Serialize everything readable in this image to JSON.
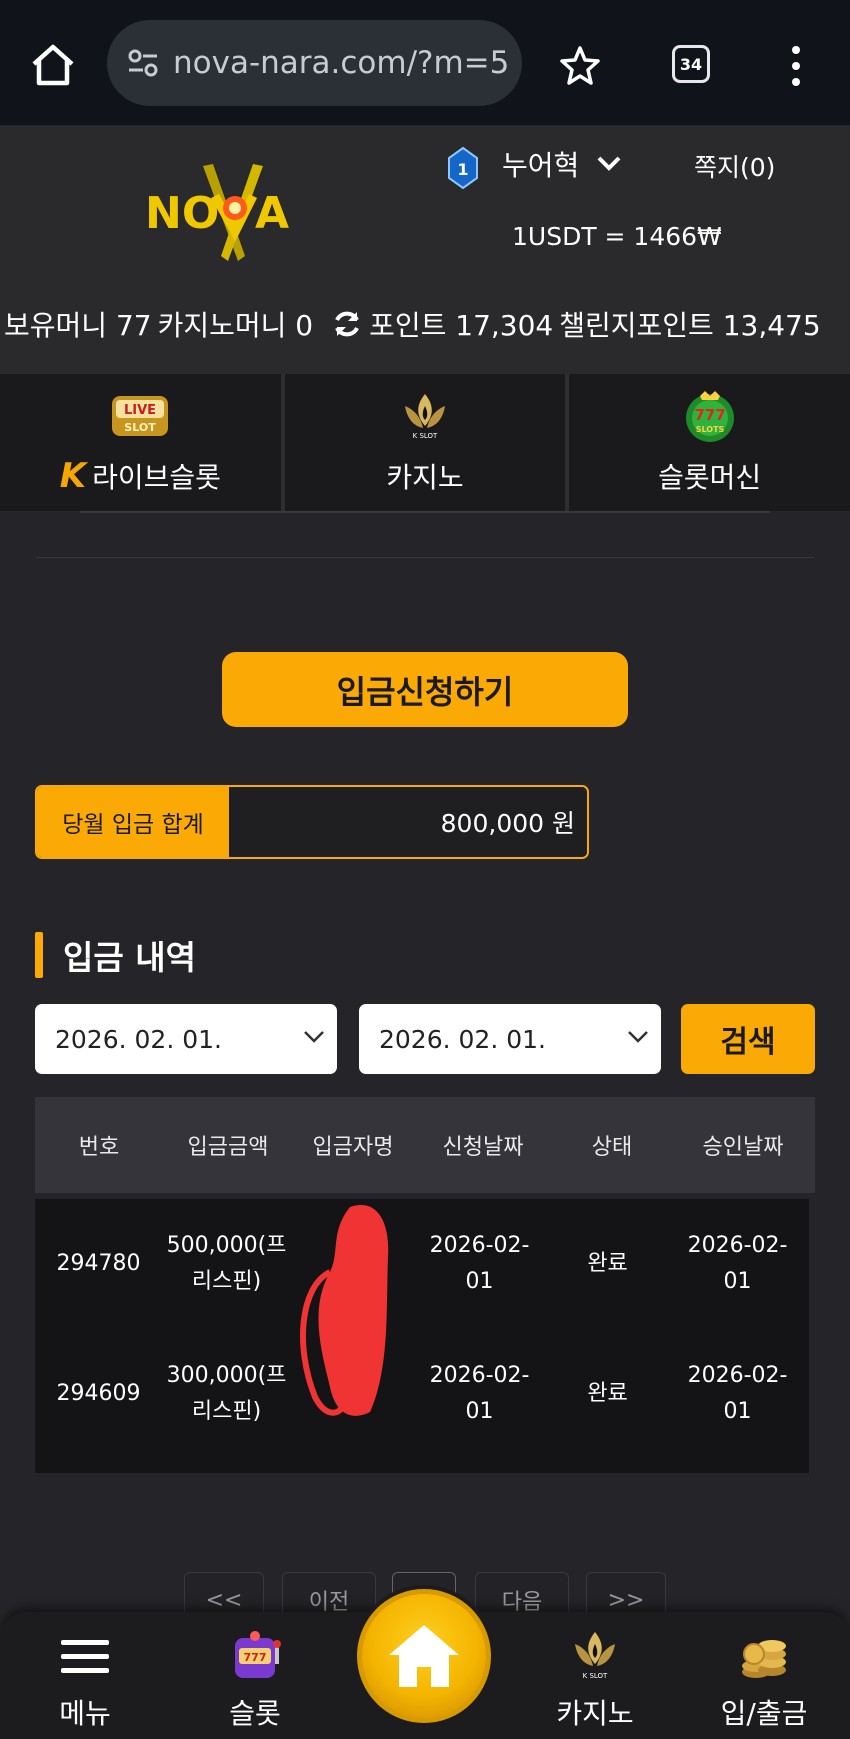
{
  "browser": {
    "url": "nova-nara.com/?m=5",
    "tab_count": "34"
  },
  "header": {
    "logo_text": "NOVA",
    "level": "1",
    "username": "누어혁",
    "messages": "쪽지(0)",
    "exchange_rate": "1USDT = 1466₩",
    "balances": {
      "holding": "보유머니 77",
      "casino": "카지노머니 0",
      "point": "포인트 17,304",
      "challenge": "챌린지포인트 13,475"
    }
  },
  "game_tabs": [
    {
      "label": "라이브슬롯",
      "icon": "live-slot-icon",
      "prefix": "K"
    },
    {
      "label": "카지노",
      "icon": "k-slot-icon"
    },
    {
      "label": "슬롯머신",
      "icon": "777-slots-icon"
    }
  ],
  "deposit": {
    "apply_button": "입금신청하기",
    "monthly_label": "당월 입금 합계",
    "monthly_value": "800,000 원",
    "history_title": "입금 내역",
    "date_from": "2026. 02. 01.",
    "date_to": "2026. 02. 01.",
    "search_button": "검색"
  },
  "table": {
    "headers": [
      "번호",
      "입금금액",
      "입금자명",
      "신청날짜",
      "상태",
      "승인날짜"
    ],
    "rows": [
      {
        "no": "294780",
        "amount_1": "500,000(프",
        "amount_2": "리스핀)",
        "name": "",
        "req_1": "2026-02-",
        "req_2": "01",
        "status": "완료",
        "app_1": "2026-02-",
        "app_2": "01"
      },
      {
        "no": "294609",
        "amount_1": "300,000(프",
        "amount_2": "리스핀)",
        "name": "",
        "req_1": "2026-02-",
        "req_2": "01",
        "status": "완료",
        "app_1": "2026-02-",
        "app_2": "01"
      }
    ]
  },
  "pagination": {
    "first": "<<",
    "prev": "이전",
    "current": "1",
    "next": "다음",
    "last": ">>"
  },
  "bottom_nav": {
    "menu": "메뉴",
    "slot": "슬롯",
    "casino": "카지노",
    "banking": "입/출금"
  },
  "colors": {
    "accent": "#fbaa05",
    "background": "#252529",
    "table_body": "#141416"
  }
}
